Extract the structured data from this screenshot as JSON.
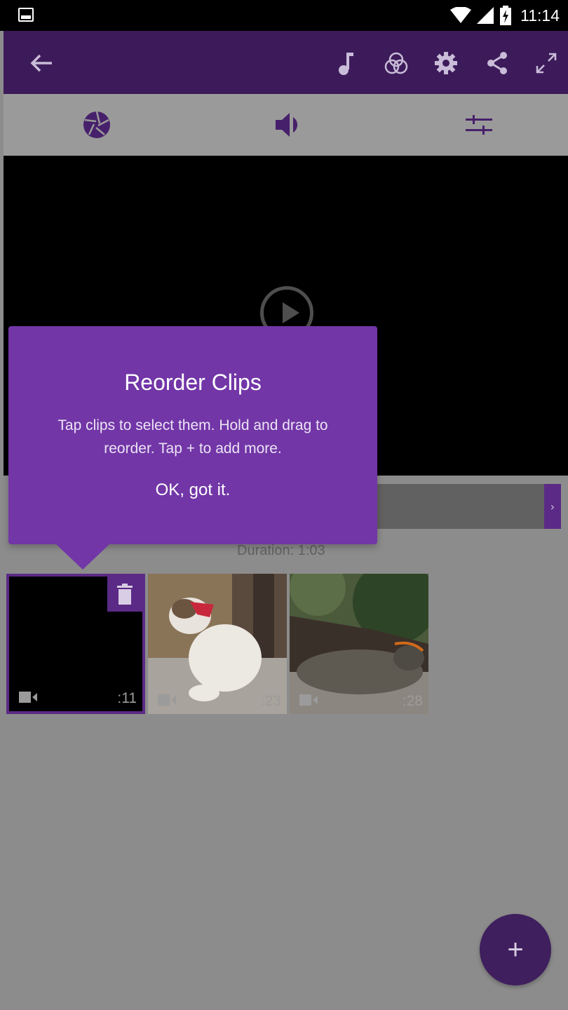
{
  "status_bar": {
    "time": "11:14"
  },
  "toolbar": {
    "icons": [
      "back-arrow-icon",
      "music-icon",
      "color-filter-icon",
      "settings-icon",
      "share-icon",
      "fullscreen-icon"
    ]
  },
  "tabs": [
    "aperture-icon",
    "volume-icon",
    "sliders-icon"
  ],
  "timeline": {
    "duration": "Duration: 1:03"
  },
  "clips": [
    {
      "time": ":11",
      "selected": true
    },
    {
      "time": ":23",
      "selected": false
    },
    {
      "time": ":28",
      "selected": false
    }
  ],
  "tooltip": {
    "title": "Reorder Clips",
    "body": "Tap clips to select them. Hold and drag to reorder. Tap + to add more.",
    "ok": "OK, got it."
  },
  "fab": {
    "label": "+"
  },
  "colors": {
    "brand_purple": "#5b2a86",
    "tooltip_purple": "#7236a7",
    "toolbar": "#3d1b5a"
  }
}
